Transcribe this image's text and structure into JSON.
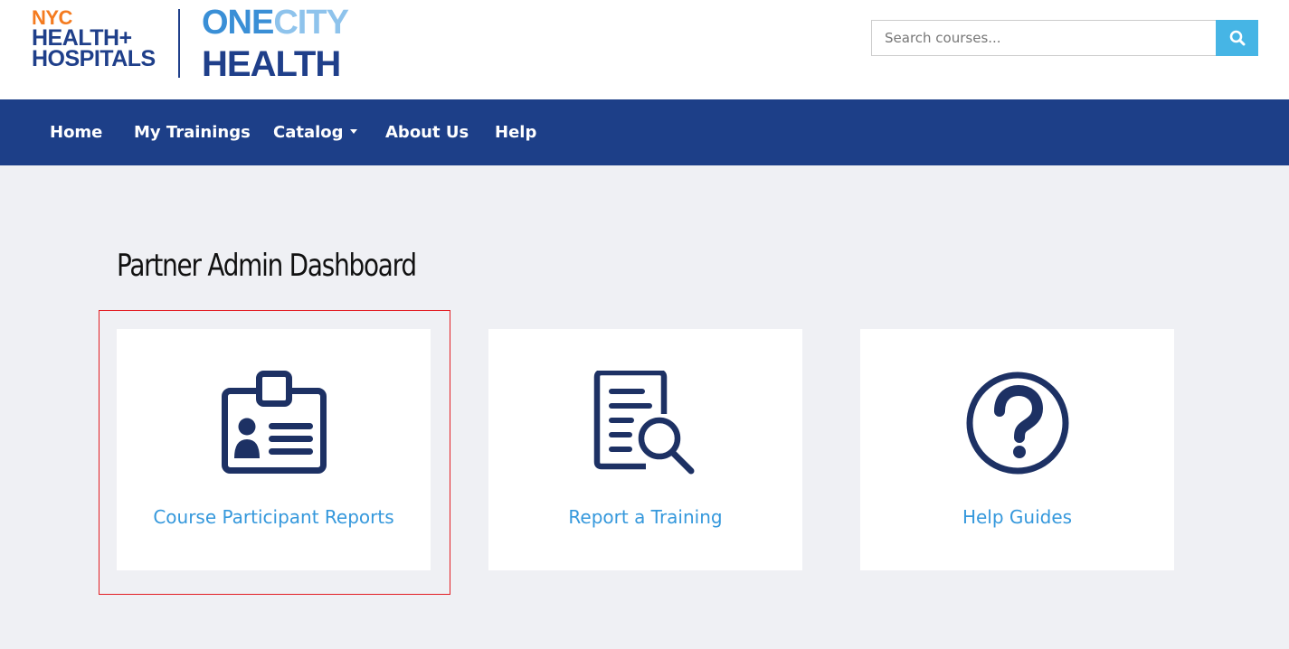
{
  "logo": {
    "nyc_line1": "NYC",
    "nyc_line2": "HEALTH+",
    "nyc_line3": "HOSPITALS",
    "och_one": "ONE",
    "och_city": "CITY",
    "och_health": "HEALTH"
  },
  "search": {
    "placeholder": "Search courses...",
    "value": "",
    "icon": "search-icon"
  },
  "nav": {
    "items": [
      {
        "label": "Home"
      },
      {
        "label": "My Trainings"
      },
      {
        "label": "Catalog",
        "dropdown": true
      },
      {
        "label": "About Us"
      },
      {
        "label": "Help"
      }
    ]
  },
  "main": {
    "title": "Partner Admin Dashboard",
    "cards": [
      {
        "label": "Course Participant Reports",
        "icon": "id-badge-icon"
      },
      {
        "label": "Report a Training",
        "icon": "document-search-icon"
      },
      {
        "label": "Help Guides",
        "icon": "question-circle-icon"
      }
    ]
  },
  "colors": {
    "nav_bg": "#1d3f88",
    "page_bg": "#eff0f4",
    "link": "#3598dc",
    "icon": "#1d3164",
    "search_button": "#46b5e5",
    "highlight": "#e31e24"
  }
}
